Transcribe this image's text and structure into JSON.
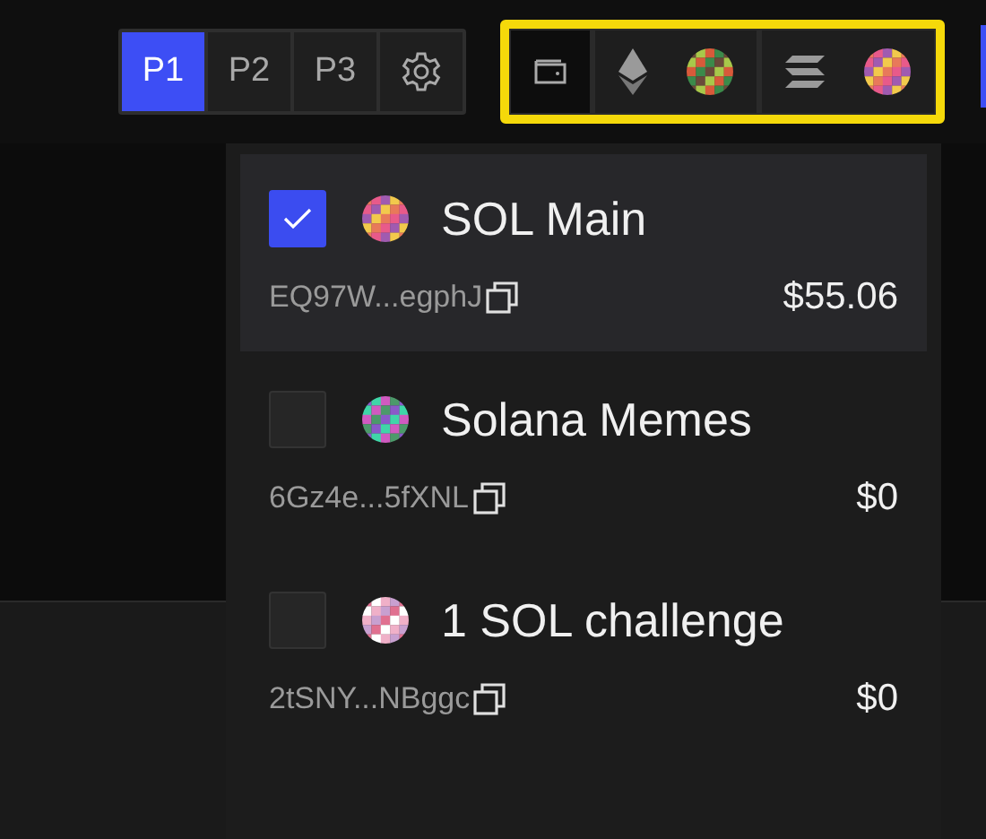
{
  "tabs": [
    {
      "label": "P1",
      "selected": true
    },
    {
      "label": "P2",
      "selected": false
    },
    {
      "label": "P3",
      "selected": false
    }
  ],
  "chains": [
    {
      "kind": "wallet",
      "selected": true
    },
    {
      "kind": "ethereum",
      "selected": false
    },
    {
      "kind": "solana",
      "selected": false
    }
  ],
  "wallets": [
    {
      "name": "SOL Main",
      "address": "EQ97W...egphJ",
      "balance": "$55.06",
      "checked": true,
      "selected": true
    },
    {
      "name": "Solana Memes",
      "address": "6Gz4e...5fXNL",
      "balance": "$0",
      "checked": false,
      "selected": false
    },
    {
      "name": "1 SOL challenge",
      "address": "2tSNY...NBggc",
      "balance": "$0",
      "checked": false,
      "selected": false
    }
  ]
}
